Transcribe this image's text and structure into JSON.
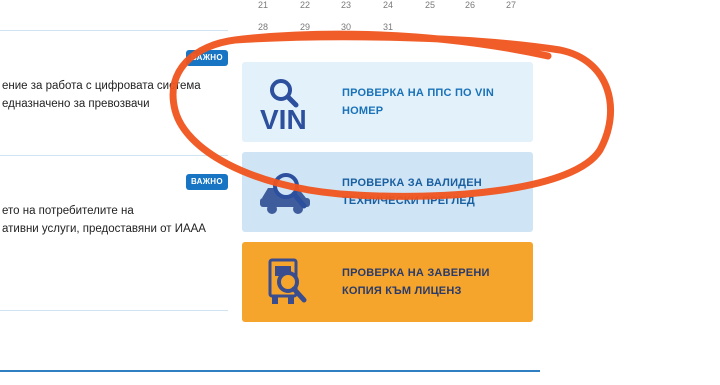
{
  "calendar": {
    "row1": [
      "21",
      "22",
      "23",
      "24",
      "25",
      "26",
      "27"
    ],
    "row2": [
      "28",
      "29",
      "30",
      "31"
    ]
  },
  "news": [
    {
      "badge": "ВАЖНО",
      "lines": [
        "ение за работа с цифровата система",
        "едназначено за превозвачи"
      ]
    },
    {
      "badge": "ВАЖНО",
      "lines": [
        "ето на потребителите на",
        "ативни услуги, предоставяни от ИААА"
      ]
    }
  ],
  "services": [
    {
      "label_line1": "ПРОВЕРКА НА ППС ПО VIN",
      "label_line2": "НОМЕР",
      "icon": "vin-search-icon",
      "icon_text": "VIN",
      "bg": "#e3f1fb"
    },
    {
      "label_line1": "ПРОВЕРКА ЗА ВАЛИДЕН",
      "label_line2": "ТЕХНИЧЕСКИ ПРЕГЛЕД",
      "icon": "car-search-icon",
      "bg": "#cfe5f6"
    },
    {
      "label_line1": "ПРОВЕРКА НА ЗАВЕРЕНИ",
      "label_line2": "КОПИЯ КЪМ ЛИЦЕНЗ",
      "icon": "truck-search-icon",
      "bg": "#f5a52c"
    }
  ],
  "colors": {
    "annotation": "#f0541e",
    "brand_blue": "#1775c4",
    "orange_card": "#f5a52c"
  }
}
